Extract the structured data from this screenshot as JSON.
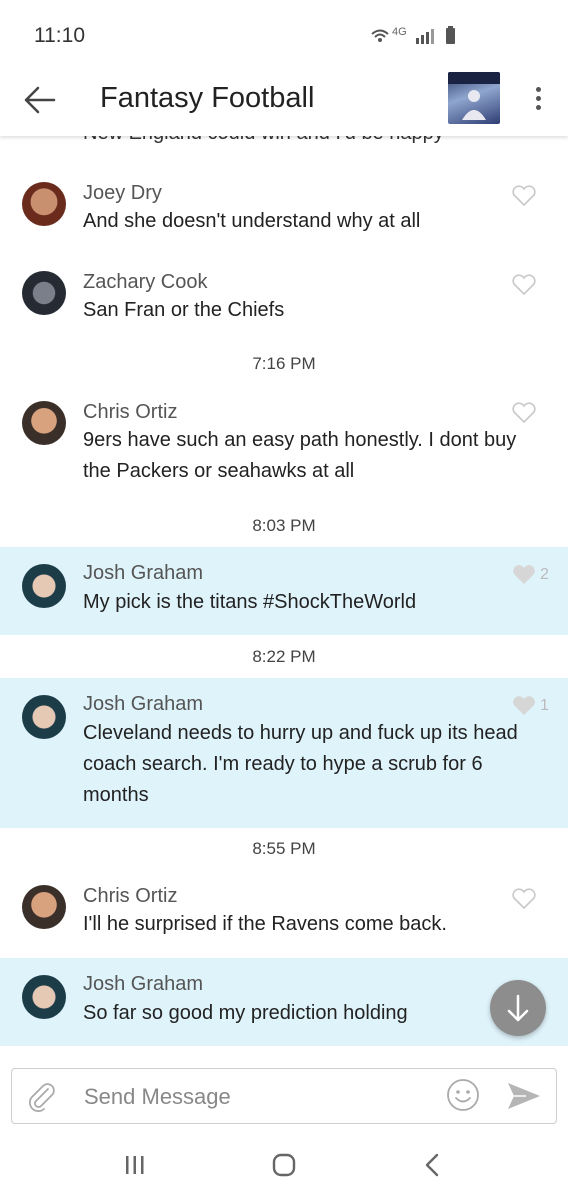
{
  "status_bar": {
    "time": "11:10",
    "network": "4G"
  },
  "header": {
    "back_icon": "arrow-left-icon",
    "title": "Fantasy Football",
    "menu_icon": "more-vertical-icon"
  },
  "feed": {
    "partial_text": "New England could win and I'd be happy",
    "items": [
      {
        "name": "Joey Dry",
        "text": "And she doesn't understand why at all",
        "likes": "",
        "highlighted": false
      },
      {
        "name": "Zachary Cook",
        "text": "San Fran or the Chiefs",
        "likes": "",
        "highlighted": false
      },
      {
        "name": "Chris Ortiz",
        "text": "9ers have such an easy path honestly. I dont buy the Packers or seahawks at all",
        "likes": "",
        "highlighted": false
      },
      {
        "name": "Josh Graham",
        "text": "My pick is the titans #ShockTheWorld",
        "likes": "2",
        "highlighted": true
      },
      {
        "name": "Josh Graham",
        "text": "Cleveland needs to hurry up and fuck up its head coach search. I'm ready to hype a scrub for 6 months",
        "likes": "1",
        "highlighted": true
      },
      {
        "name": "Chris Ortiz",
        "text": "I'll he surprised if the Ravens come back.",
        "likes": "",
        "highlighted": false
      },
      {
        "name": "Josh Graham",
        "text": "So far so good my prediction holding",
        "likes": "",
        "highlighted": true
      }
    ],
    "timestamps": [
      "7:16 PM",
      "8:03 PM",
      "8:22 PM",
      "8:55 PM"
    ]
  },
  "composer": {
    "placeholder": "Send Message",
    "attach_icon": "paperclip-icon",
    "emoji_icon": "smiley-icon",
    "send_icon": "send-icon"
  },
  "scroll_button": {
    "icon": "arrow-down-icon"
  },
  "colors": {
    "highlight": "#dff3fb",
    "fab": "#8d8d8d",
    "heart_outline": "#c8c8c8",
    "heart_filled": "#d6d6d6"
  },
  "system_nav": {
    "recents_icon": "recents-icon",
    "home_icon": "home-icon",
    "back_icon": "nav-back-icon"
  }
}
